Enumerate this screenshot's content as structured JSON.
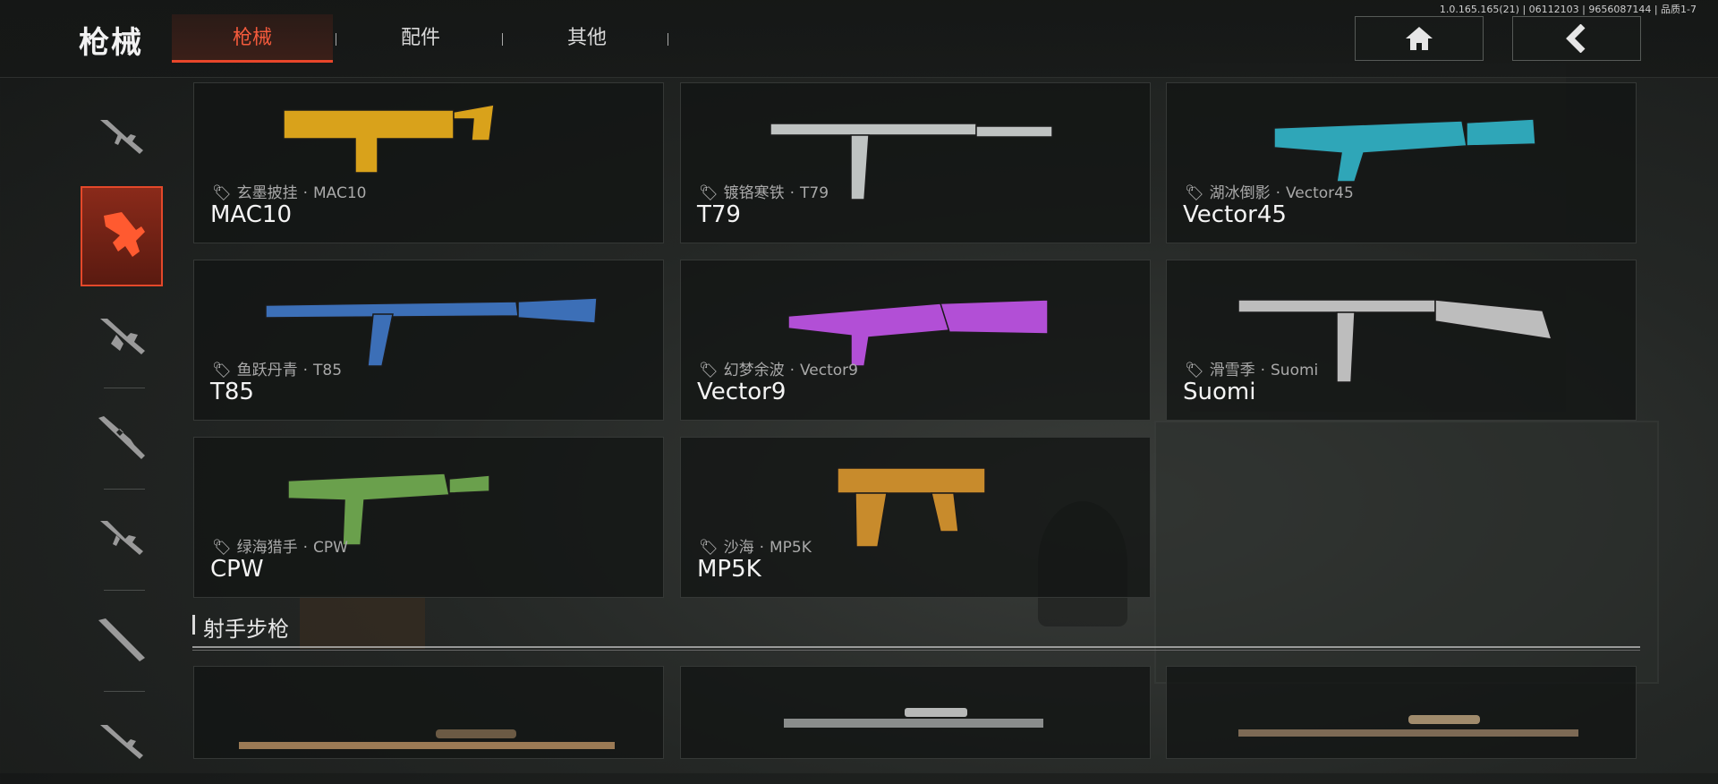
{
  "header": {
    "title": "枪械",
    "tabs": [
      {
        "label": "枪械",
        "active": true
      },
      {
        "label": "配件",
        "active": false
      },
      {
        "label": "其他",
        "active": false
      }
    ],
    "version": "1.0.165.165(21) | 06112103 | 9656087144 | 品质1-7",
    "home_icon": "home-icon",
    "back_icon": "back-chevron-icon",
    "accent": "#e8462a"
  },
  "sidebar": {
    "items": [
      {
        "icon": "assault-rifle-icon"
      },
      {
        "icon": "smg-icon",
        "active": true
      },
      {
        "icon": "lmg-icon"
      },
      {
        "icon": "sniper-rifle-icon"
      },
      {
        "icon": "rifle-icon"
      },
      {
        "icon": "marksman-rifle-icon"
      },
      {
        "icon": "shotgun-icon"
      }
    ]
  },
  "weapons": [
    {
      "skin": "玄墨披挂",
      "model": "MAC10",
      "name": "MAC10"
    },
    {
      "skin": "镀铬寒铁",
      "model": "T79",
      "name": "T79"
    },
    {
      "skin": "湖冰倒影",
      "model": "Vector45",
      "name": "Vector45"
    },
    {
      "skin": "鱼跃丹青",
      "model": "T85",
      "name": "T85"
    },
    {
      "skin": "幻梦余波",
      "model": "Vector9",
      "name": "Vector9"
    },
    {
      "skin": "滑雪季",
      "model": "Suomi",
      "name": "Suomi"
    },
    {
      "skin": "绿海猎手",
      "model": "CPW",
      "name": "CPW"
    },
    {
      "skin": "沙海",
      "model": "MP5K",
      "name": "MP5K"
    }
  ],
  "weapon_colors": [
    "#d9a21b",
    "#bfc3c2",
    "#2fa6b8",
    "#3c6fb7",
    "#b24fd6",
    "#bdbdbd",
    "#6aa04c",
    "#c88b2c"
  ],
  "skin_separator": "·",
  "section": {
    "title": "射手步枪"
  }
}
